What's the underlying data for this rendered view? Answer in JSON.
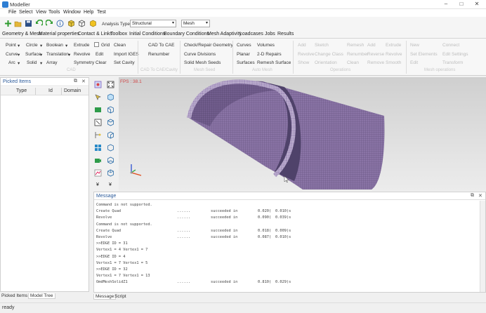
{
  "window": {
    "title": "Modeller",
    "minimize_glyph": "–",
    "maximize_glyph": "□",
    "close_glyph": "✕"
  },
  "menu": [
    "File",
    "Select",
    "View",
    "Tools",
    "Window",
    "Help",
    "Test"
  ],
  "toolbar": {
    "analysis_type_label": "Analysis Type",
    "analysis_type_value": "Structural",
    "mesh_value": "Mesh"
  },
  "ribbon_tabs": [
    "Geometry & Mesh",
    "Material properties",
    "Contact & Links",
    "Toolbox",
    "Initial Conditions",
    "Boundary Conditions",
    "Mesh Adaptivity",
    "Loadcases",
    "Jobs",
    "Results"
  ],
  "ribbon": {
    "geom": {
      "point": "Point",
      "circle": "Circle",
      "boolean": "Boolean",
      "extrude": "Extrude",
      "grid": "Grid",
      "clean": "Clean",
      "curve": "Curve",
      "surface": "Surface",
      "translation": "Translation",
      "revolve": "Revolve",
      "edit": "Edit",
      "import_iges": "Import IGES",
      "arc": "Arc",
      "solid": "Solid",
      "array": "Array",
      "symmetry": "Symmetry",
      "clear": "Clear",
      "set_cavity": "Set Cavity",
      "group": "CAD"
    },
    "cad": {
      "cad_to_cae": "CAD To CAE",
      "renumber": "Renumber",
      "group": "CAD To CAE/Cavity"
    },
    "check": {
      "check_repair": "Check/Repair Geometry",
      "curve_divisions": "Curve Divisions",
      "solid_mesh_seeds": "Solid Mesh Seeds",
      "group": "Mesh Seed"
    },
    "mesh": {
      "curves": "Curves",
      "volumes": "Volumes",
      "planar": "Planar",
      "repairs_2d": "2-D Repairs",
      "surfaces": "Surfaces",
      "remesh": "Remesh Surface",
      "group": "Auto Mesh"
    },
    "faded1": {
      "a1": "Add",
      "a2": "Sketch",
      "a3": "Remesh",
      "a4": "Add",
      "a5": "Extrude",
      "b1": "Revolve",
      "b2": "Change Class",
      "b3": "Renumber",
      "b4": "Reverse",
      "b5": "Revolve",
      "c1": "Show",
      "c2": "Orientation",
      "c3": "Clean",
      "c4": "Remove",
      "c5": "Smooth",
      "group": "Operations"
    },
    "faded2": {
      "a1": "New",
      "a2": "Connect",
      "b1": "Set Elements",
      "b2": "Edit Settings",
      "c1": "Edit",
      "c2": "Transform",
      "group": "Mesh operations"
    }
  },
  "picked_items": {
    "title": "Picked Items",
    "columns": [
      "Type",
      "Id",
      "Domain"
    ]
  },
  "left_tabs": [
    "Picked Items",
    "Model Tree"
  ],
  "viewport": {
    "fps": "FPS : 38.1"
  },
  "message": {
    "title": "Message",
    "lines": [
      {
        "text": "Command is not supported."
      },
      {
        "text": "Create Quad",
        "dots": "......",
        "status": "succeeded in",
        "t1": "0.020(",
        "t2": "0.010)s"
      },
      {
        "text": "Revolve",
        "dots": "......",
        "status": "succeeded in",
        "t1": "0.090(",
        "t2": "0.039)s"
      },
      {
        "text": "Command is not supported."
      },
      {
        "text": "Create Quad",
        "dots": "......",
        "status": "succeeded in",
        "t1": "0.018(",
        "t2": "0.009)s"
      },
      {
        "text": "Revolve",
        "dots": "......",
        "status": "succeeded in",
        "t1": "0.087(",
        "t2": "0.010)s"
      },
      {
        "text": ">>EDGE ID = 31"
      },
      {
        "text": "Vertex1 = 4 Vertex1 = 7"
      },
      {
        "text": ">>EDGE ID = 4"
      },
      {
        "text": "Vertex1 = 7 Vertex1 = 5"
      },
      {
        "text": ">>EDGE ID = 32"
      },
      {
        "text": "Vertex1 = 7 Vertex1 = 13"
      },
      {
        "text": "OmdMeshSolidZ1",
        "dots": "......",
        "status": "succeeded in",
        "t1": "0.810(",
        "t2": "0.029)s"
      }
    ]
  },
  "msg_tabs": [
    "Message",
    "Script"
  ],
  "status": "ready"
}
